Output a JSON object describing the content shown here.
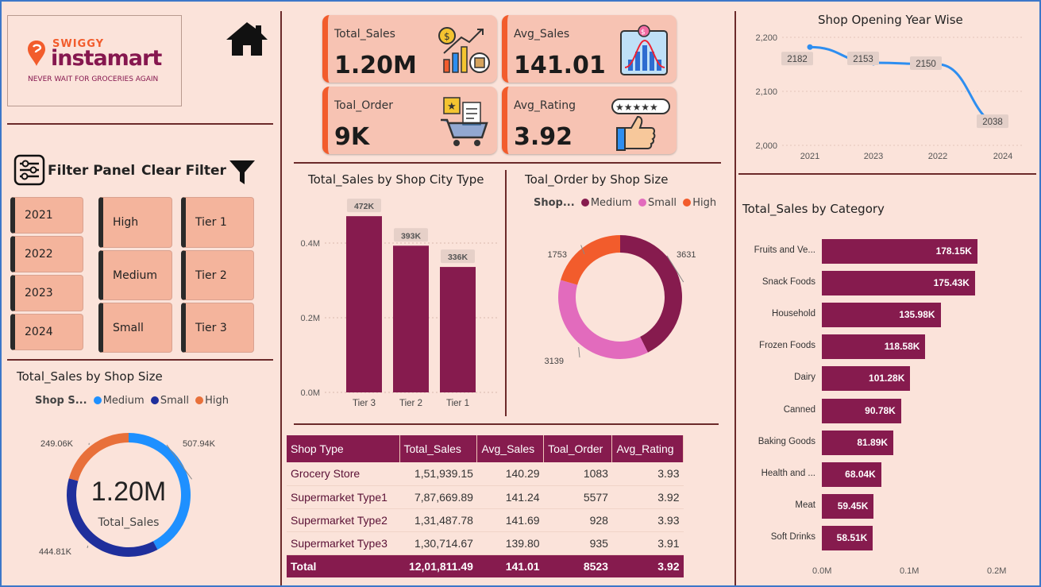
{
  "brand": {
    "name_top": "SWIGGY",
    "name_main": "instamart",
    "tagline": "NEVER WAIT FOR GROCERIES AGAIN"
  },
  "kpis": [
    {
      "label": "Total_Sales",
      "value": "1.20M",
      "icon": "sales-growth-icon"
    },
    {
      "label": "Avg_Sales",
      "value": "141.01",
      "icon": "bell-curve-chart-icon"
    },
    {
      "label": "Toal_Order",
      "value": "9K",
      "icon": "shopping-cart-icon"
    },
    {
      "label": "Avg_Rating",
      "value": "3.92",
      "icon": "rating-thumbs-up-icon"
    }
  ],
  "filter": {
    "panel_label": "Filter Panel",
    "clear_label": "Clear Filter"
  },
  "slicers": {
    "years": [
      "2021",
      "2022",
      "2023",
      "2024"
    ],
    "sizes": [
      "High",
      "Medium",
      "Small"
    ],
    "tiers": [
      "Tier 1",
      "Tier 2",
      "Tier 3"
    ]
  },
  "colors": {
    "accent": "#861b4e",
    "medium": "#1e90ff",
    "small": "#1f2f9c",
    "high": "#e8703a",
    "pie_medium": "#861b4e",
    "pie_small": "#e26bbd",
    "pie_high": "#f25c2c",
    "line": "#2e8ef0"
  },
  "chart_data": [
    {
      "type": "pie",
      "title": "Total_Sales by Shop Size",
      "legend_title": "Shop S...",
      "categories": [
        "Medium",
        "Small",
        "High"
      ],
      "values": [
        507.94,
        444.81,
        249.06
      ],
      "value_labels": [
        "507.94K",
        "444.81K",
        "249.06K"
      ],
      "center_value": "1.20M",
      "center_label": "Total_Sales"
    },
    {
      "type": "bar",
      "title": "Total_Sales by Shop City Type",
      "categories": [
        "Tier 3",
        "Tier 2",
        "Tier 1"
      ],
      "values": [
        472,
        393,
        336
      ],
      "value_labels": [
        "472K",
        "393K",
        "336K"
      ],
      "yticks": [
        "0.0M",
        "0.2M",
        "0.4M"
      ],
      "ylim": [
        0,
        0.5
      ]
    },
    {
      "type": "pie",
      "title": "Toal_Order by Shop Size",
      "legend_title": "Shop...",
      "categories": [
        "Medium",
        "Small",
        "High"
      ],
      "values": [
        3631,
        3139,
        1753
      ],
      "value_labels": [
        "3631",
        "3139",
        "1753"
      ]
    },
    {
      "type": "line",
      "title": "Shop Opening Year Wise",
      "categories": [
        "2021",
        "2023",
        "2022",
        "2024"
      ],
      "values": [
        2182,
        2153,
        2150,
        2038
      ],
      "value_labels": [
        "2182",
        "2153",
        "2150",
        "2038"
      ],
      "yticks": [
        "2,000",
        "2,100",
        "2,200"
      ],
      "ylim": [
        2000,
        2200
      ]
    },
    {
      "type": "bar",
      "title": "Total_Sales by Category",
      "categories": [
        "Fruits and Ve...",
        "Snack Foods",
        "Household",
        "Frozen Foods",
        "Dairy",
        "Canned",
        "Baking Goods",
        "Health and ...",
        "Meat",
        "Soft Drinks"
      ],
      "values": [
        178.15,
        175.43,
        135.98,
        118.58,
        101.28,
        90.78,
        81.89,
        68.04,
        59.45,
        58.51
      ],
      "value_labels": [
        "178.15K",
        "175.43K",
        "135.98K",
        "118.58K",
        "101.28K",
        "90.78K",
        "81.89K",
        "68.04K",
        "59.45K",
        "58.51K"
      ],
      "xticks": [
        "0.0M",
        "0.1M",
        "0.2M"
      ],
      "xlim": [
        0,
        0.2
      ]
    }
  ],
  "table": {
    "headers": [
      "Shop Type",
      "Total_Sales",
      "Avg_Sales",
      "Toal_Order",
      "Avg_Rating"
    ],
    "rows": [
      [
        "Grocery Store",
        "1,51,939.15",
        "140.29",
        "1083",
        "3.93"
      ],
      [
        "Supermarket Type1",
        "7,87,669.89",
        "141.24",
        "5577",
        "3.92"
      ],
      [
        "Supermarket Type2",
        "1,31,487.78",
        "141.69",
        "928",
        "3.93"
      ],
      [
        "Supermarket Type3",
        "1,30,714.67",
        "139.80",
        "935",
        "3.91"
      ]
    ],
    "total": [
      "Total",
      "12,01,811.49",
      "141.01",
      "8523",
      "3.92"
    ]
  }
}
